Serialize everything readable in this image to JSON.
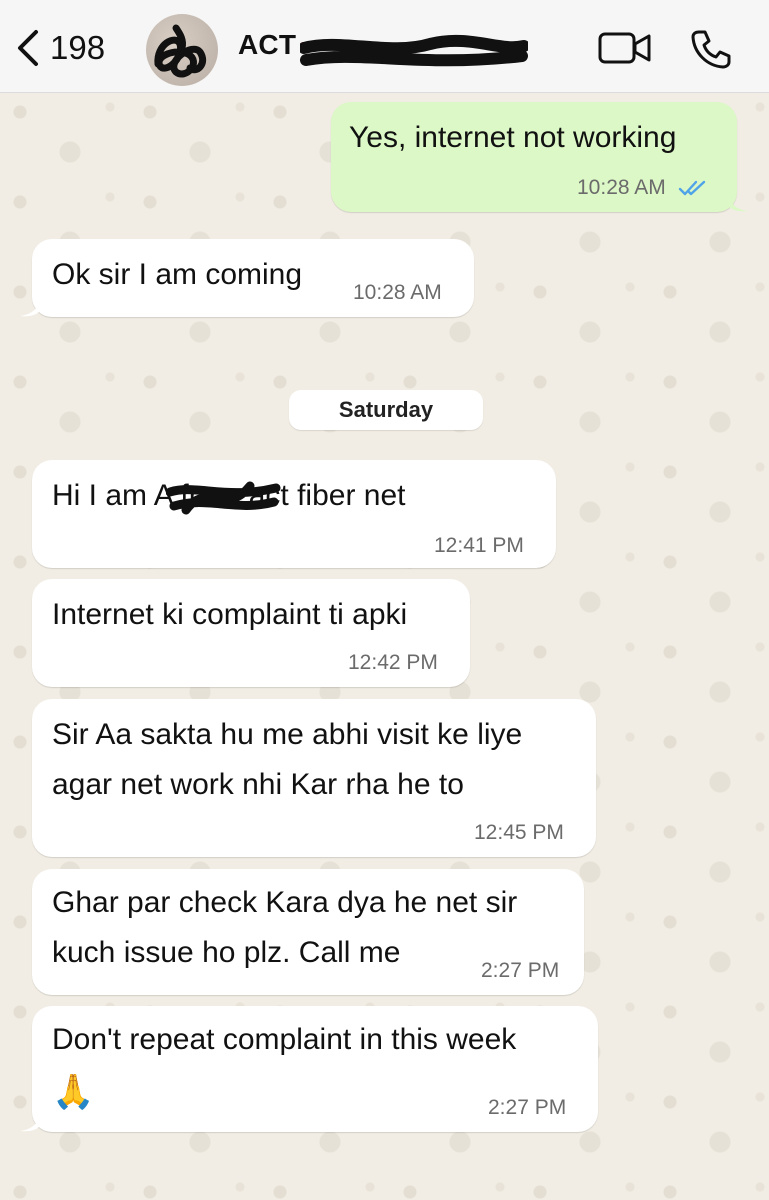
{
  "header": {
    "back_count": "198",
    "contact_name": "ACT S          ar",
    "contact_prefix": "ACT"
  },
  "date_separator": "Saturday",
  "messages": [
    {
      "direction": "out",
      "text": "Yes, internet not working",
      "time": "10:28 AM",
      "status": "read"
    },
    {
      "direction": "in",
      "text": "Ok sir I am coming",
      "time": "10:28 AM"
    },
    {
      "direction": "in",
      "text": "Hi I am A        from act fiber net",
      "time": "12:41 PM"
    },
    {
      "direction": "in",
      "text": "Internet ki complaint ti apki",
      "time": "12:42 PM"
    },
    {
      "direction": "in",
      "lines": [
        "Sir Aa sakta hu me abhi visit ke liye",
        "agar net work nhi Kar rha he to"
      ],
      "time": "12:45 PM"
    },
    {
      "direction": "in",
      "lines": [
        "Ghar par check Kara dya he net sir",
        "kuch issue ho plz. Call me"
      ],
      "time": "2:27 PM"
    },
    {
      "direction": "in",
      "lines": [
        "Don't repeat complaint in this week",
        "🙏"
      ],
      "time": "2:27 PM"
    }
  ],
  "colors": {
    "outgoing_bubble": "#dcf8c6",
    "incoming_bubble": "#ffffff",
    "read_ticks": "#4fa3e8",
    "background": "#efeae2"
  }
}
